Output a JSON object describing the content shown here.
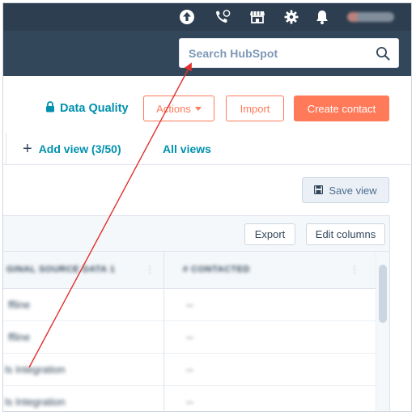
{
  "nav": {
    "icons": [
      "upgrade-icon",
      "calling-icon",
      "marketplace-icon",
      "settings-icon",
      "notifications-icon",
      "account-avatar"
    ]
  },
  "search": {
    "placeholder": "Search HubSpot"
  },
  "actions": {
    "data_quality": "Data Quality",
    "actions_label": "Actions",
    "import_label": "Import",
    "create_label": "Create contact"
  },
  "views": {
    "add_view": "Add view (3/50)",
    "all_views": "All views"
  },
  "save_view": "Save view",
  "table": {
    "export_label": "Export",
    "edit_columns_label": "Edit columns",
    "headers": [
      "GINAL SOURCE DATA 1",
      "# CONTACTED"
    ],
    "rows": [
      [
        "ffline",
        "--"
      ],
      [
        "ffline",
        "--"
      ],
      [
        "ls Integration",
        "--"
      ],
      [
        "ls Integration",
        "--"
      ]
    ]
  },
  "colors": {
    "nav_bg": "#2d3e50",
    "search_bar_bg": "#33475b",
    "accent_orange": "#ff7a59",
    "link_teal": "#0091ae",
    "arrow_red": "#e0302e"
  }
}
